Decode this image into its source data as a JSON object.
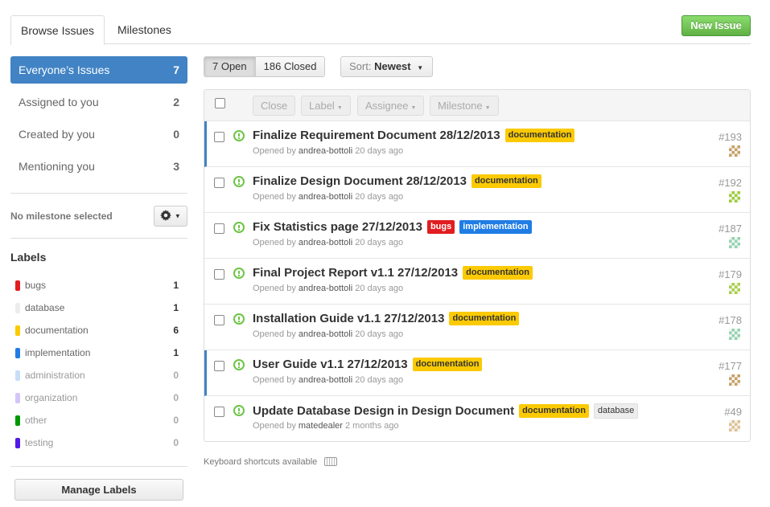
{
  "tabs": [
    {
      "label": "Browse Issues",
      "active": true
    },
    {
      "label": "Milestones",
      "active": false
    }
  ],
  "new_issue_label": "New Issue",
  "filters": [
    {
      "label": "Everyone’s Issues",
      "count": "7",
      "active": true
    },
    {
      "label": "Assigned to you",
      "count": "2",
      "active": false
    },
    {
      "label": "Created by you",
      "count": "0",
      "active": false
    },
    {
      "label": "Mentioning you",
      "count": "3",
      "active": false
    }
  ],
  "milestone": {
    "label": "No milestone selected",
    "icon": "gear-icon"
  },
  "labels_heading": "Labels",
  "labels": [
    {
      "name": "bugs",
      "count": "1",
      "color": "#e11d21"
    },
    {
      "name": "database",
      "count": "1",
      "color": "#ededed"
    },
    {
      "name": "documentation",
      "count": "6",
      "color": "#fbca04"
    },
    {
      "name": "implementation",
      "count": "1",
      "color": "#207de5"
    },
    {
      "name": "administration",
      "count": "0",
      "color": "#c7def8"
    },
    {
      "name": "organization",
      "count": "0",
      "color": "#d4c5f9"
    },
    {
      "name": "other",
      "count": "0",
      "color": "#009800"
    },
    {
      "name": "testing",
      "count": "0",
      "color": "#5319e7"
    }
  ],
  "manage_labels": "Manage Labels",
  "state": {
    "open": "7 Open",
    "closed": "186 Closed",
    "selected": "open"
  },
  "sort": {
    "prefix": "Sort:",
    "value": "Newest"
  },
  "bulk_actions": {
    "close": "Close",
    "label": "Label",
    "assignee": "Assignee",
    "milestone": "Milestone"
  },
  "issues": [
    {
      "title": "Finalize Requirement Document 28/12/2013",
      "labels": [
        "documentation"
      ],
      "opened_by": "Opened by",
      "author": "andrea-bottoli",
      "time": "20 days ago",
      "number": "#193",
      "avatar_color": "#c8a060",
      "marked": true
    },
    {
      "title": "Finalize Design Document 28/12/2013",
      "labels": [
        "documentation"
      ],
      "opened_by": "Opened by",
      "author": "andrea-bottoli",
      "time": "20 days ago",
      "number": "#192",
      "avatar_color": "#9acd32",
      "marked": false
    },
    {
      "title": "Fix Statistics page 27/12/2013",
      "labels": [
        "bugs",
        "implementation"
      ],
      "opened_by": "Opened by",
      "author": "andrea-bottoli",
      "time": "20 days ago",
      "number": "#187",
      "avatar_color": "#8fd4b0",
      "marked": false
    },
    {
      "title": "Final Project Report v1.1 27/12/2013",
      "labels": [
        "documentation"
      ],
      "opened_by": "Opened by",
      "author": "andrea-bottoli",
      "time": "20 days ago",
      "number": "#179",
      "avatar_color": "#a8d040",
      "marked": false
    },
    {
      "title": "Installation Guide v1.1 27/12/2013",
      "labels": [
        "documentation"
      ],
      "opened_by": "Opened by",
      "author": "andrea-bottoli",
      "time": "20 days ago",
      "number": "#178",
      "avatar_color": "#8fd4b0",
      "marked": false
    },
    {
      "title": "User Guide v1.1 27/12/2013",
      "labels": [
        "documentation"
      ],
      "opened_by": "Opened by",
      "author": "andrea-bottoli",
      "time": "20 days ago",
      "number": "#177",
      "avatar_color": "#c8a060",
      "marked": true
    },
    {
      "title": "Update Database Design in Design Document",
      "labels": [
        "documentation",
        "database"
      ],
      "opened_by": "Opened by",
      "author": "matedealer",
      "time": "2 months ago",
      "number": "#49",
      "avatar_color": "#e0c090",
      "marked": false
    }
  ],
  "shortcuts_text": "Keyboard shortcuts available",
  "colors": {
    "accent": "#4183c4",
    "new_issue": "#60b044",
    "open_icon": "#6cc644"
  }
}
